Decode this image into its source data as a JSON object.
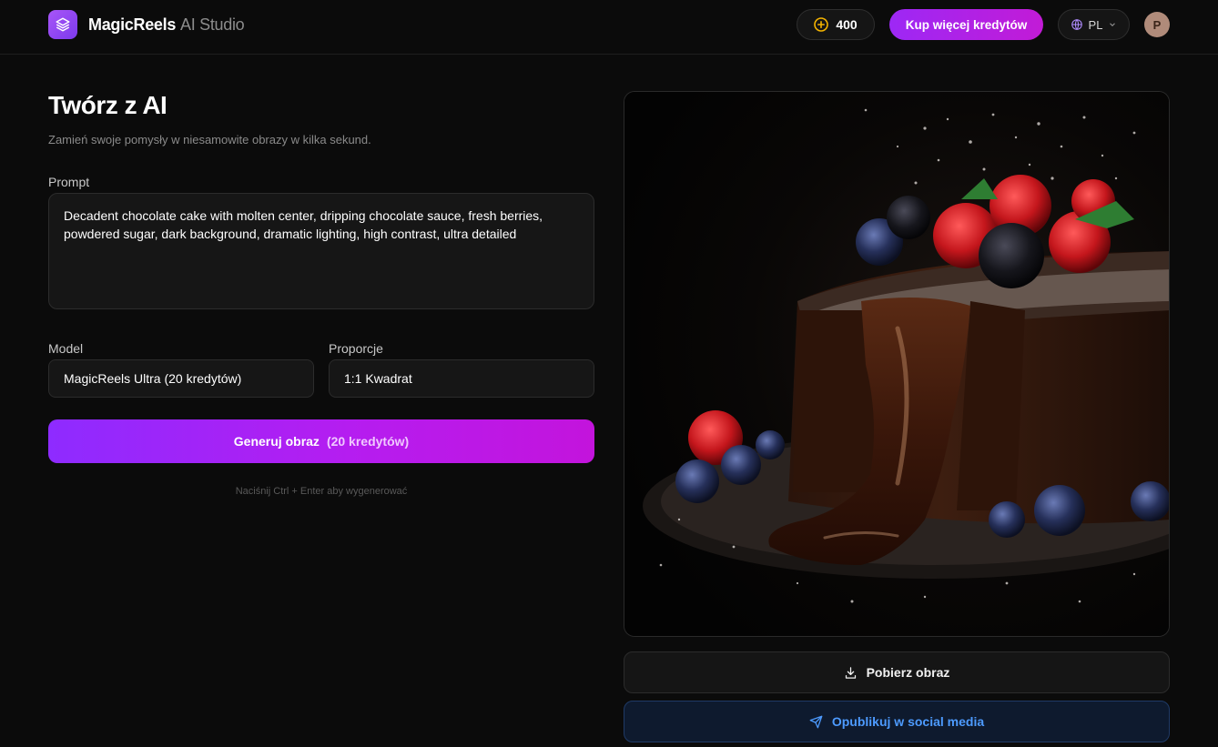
{
  "header": {
    "brand_name": "MagicReels",
    "brand_sub": "AI Studio",
    "credits": "400",
    "buy_label": "Kup więcej kredytów",
    "language": "PL",
    "avatar_initial": "P"
  },
  "main": {
    "title": "Twórz z AI",
    "subtitle": "Zamień swoje pomysły w niesamowite obrazy w kilka sekund.",
    "prompt_label": "Prompt",
    "prompt_value": "Decadent chocolate cake with molten center, dripping chocolate sauce, fresh berries, powdered sugar, dark background, dramatic lighting, high contrast, ultra detailed",
    "model_label": "Model",
    "model_value": "MagicReels Ultra (20 kredytów)",
    "ratio_label": "Proporcje",
    "ratio_value": "1:1 Kwadrat",
    "generate_label": "Generuj obraz",
    "generate_cost": "(20 kredytów)",
    "hint": "Naciśnij Ctrl + Enter aby wygenerować"
  },
  "result": {
    "download_label": "Pobierz obraz",
    "publish_label": "Opublikuj w social media"
  },
  "icons": {
    "logo": "layers-icon",
    "credits": "coin-icon",
    "language": "globe-icon",
    "language_dropdown": "chevron-down-icon",
    "download": "download-icon",
    "publish": "send-icon"
  },
  "colors": {
    "background": "#0b0b0b",
    "accent_purple": "#9d28f5",
    "accent_magenta": "#c314dc",
    "coin": "#f5b400",
    "publish_blue": "#4d9bff"
  }
}
